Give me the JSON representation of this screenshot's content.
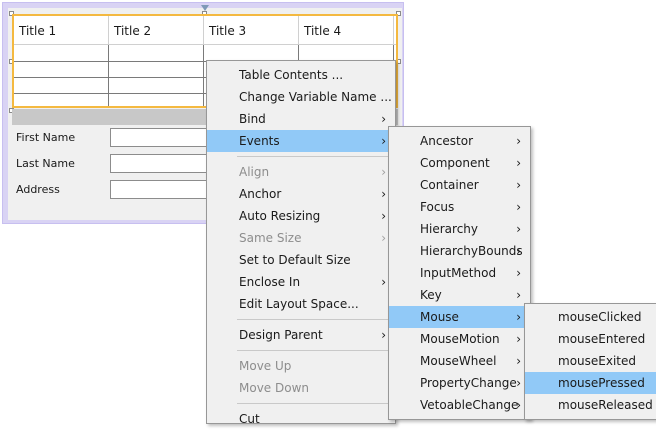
{
  "table": {
    "headers": [
      "Title 1",
      "Title 2",
      "Title 3",
      "Title 4"
    ],
    "rows": 4
  },
  "form": {
    "first_name_label": "First Name",
    "last_name_label": "Last Name",
    "address_label": "Address",
    "first_name_value": "",
    "last_name_value": "",
    "address_value": ""
  },
  "context_menu": {
    "items": [
      {
        "label": "Table Contents ...",
        "enabled": true,
        "submenu": false
      },
      {
        "label": "Change Variable Name ...",
        "enabled": true,
        "submenu": false
      },
      {
        "label": "Bind",
        "enabled": true,
        "submenu": true
      },
      {
        "label": "Events",
        "enabled": true,
        "submenu": true,
        "highlighted": true
      },
      {
        "label": "Align",
        "enabled": false,
        "submenu": true
      },
      {
        "label": "Anchor",
        "enabled": true,
        "submenu": true
      },
      {
        "label": "Auto Resizing",
        "enabled": true,
        "submenu": true
      },
      {
        "label": "Same Size",
        "enabled": false,
        "submenu": true
      },
      {
        "label": "Set to Default Size",
        "enabled": true,
        "submenu": false
      },
      {
        "label": "Enclose In",
        "enabled": true,
        "submenu": true
      },
      {
        "label": "Edit Layout Space...",
        "enabled": true,
        "submenu": false
      },
      {
        "label": "Design Parent",
        "enabled": true,
        "submenu": true
      },
      {
        "label": "Move Up",
        "enabled": false,
        "submenu": false
      },
      {
        "label": "Move Down",
        "enabled": false,
        "submenu": false
      },
      {
        "label": "Cut",
        "enabled": true,
        "submenu": false
      }
    ]
  },
  "events_menu": {
    "items": [
      {
        "label": "Ancestor",
        "highlighted": false
      },
      {
        "label": "Component",
        "highlighted": false
      },
      {
        "label": "Container",
        "highlighted": false
      },
      {
        "label": "Focus",
        "highlighted": false
      },
      {
        "label": "Hierarchy",
        "highlighted": false
      },
      {
        "label": "HierarchyBounds",
        "highlighted": false
      },
      {
        "label": "InputMethod",
        "highlighted": false
      },
      {
        "label": "Key",
        "highlighted": false
      },
      {
        "label": "Mouse",
        "highlighted": true
      },
      {
        "label": "MouseMotion",
        "highlighted": false
      },
      {
        "label": "MouseWheel",
        "highlighted": false
      },
      {
        "label": "PropertyChange",
        "highlighted": false
      },
      {
        "label": "VetoableChange",
        "highlighted": false
      }
    ]
  },
  "mouse_menu": {
    "items": [
      {
        "label": "mouseClicked",
        "highlighted": false
      },
      {
        "label": "mouseEntered",
        "highlighted": false
      },
      {
        "label": "mouseExited",
        "highlighted": false
      },
      {
        "label": "mousePressed",
        "highlighted": true
      },
      {
        "label": "mouseReleased",
        "highlighted": false
      }
    ]
  },
  "colors": {
    "highlight": "#91c9f7",
    "menu_background": "#f0f0f0",
    "selection_border": "#f4b940",
    "form_frame": "#d9d3f4"
  },
  "icons": {
    "submenu": "chevron-right-icon",
    "anchor": "anchor-marker-icon",
    "resize": "resize-handle-icon"
  }
}
